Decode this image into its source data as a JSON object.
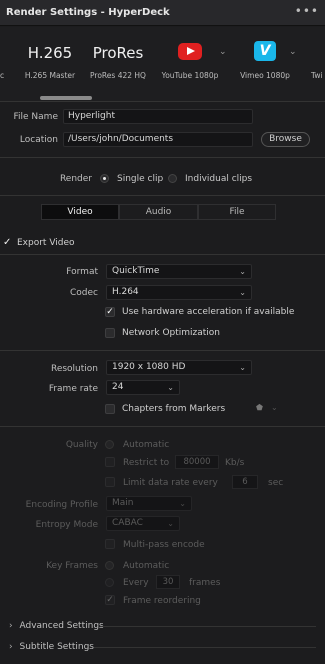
{
  "header": {
    "title": "Render Settings - HyperDeck",
    "menu_glyph": "•••"
  },
  "presets": [
    {
      "id": "h265-partial",
      "big": "",
      "label": "c"
    },
    {
      "id": "h265-master",
      "big": "H.265",
      "label": "H.265 Master"
    },
    {
      "id": "prores",
      "big": "ProRes",
      "label": "ProRes 422 HQ"
    },
    {
      "id": "youtube",
      "big": "",
      "label": "YouTube 1080p",
      "icon": "youtube-icon"
    },
    {
      "id": "vimeo",
      "big": "",
      "label": "Vimeo 1080p",
      "icon": "vimeo-icon",
      "glyph": "V"
    },
    {
      "id": "twitter-partial",
      "big": "",
      "label": "Twi"
    }
  ],
  "file": {
    "filename_label": "File Name",
    "filename_value": "Hyperlight",
    "location_label": "Location",
    "location_value": "/Users/john/Documents",
    "browse_label": "Browse"
  },
  "render": {
    "label": "Render",
    "single_clip": "Single clip",
    "individual_clips": "Individual clips",
    "selected": "single"
  },
  "tabs": [
    {
      "label": "Video",
      "active": true
    },
    {
      "label": "Audio",
      "active": false
    },
    {
      "label": "File",
      "active": false
    }
  ],
  "export_video": {
    "label": "Export Video",
    "checked": true
  },
  "format": {
    "label": "Format",
    "value": "QuickTime"
  },
  "codec": {
    "label": "Codec",
    "value": "H.264"
  },
  "hardware_accel": {
    "label": "Use hardware acceleration if available",
    "checked": true
  },
  "network_opt": {
    "label": "Network Optimization",
    "checked": false
  },
  "resolution": {
    "label": "Resolution",
    "value": "1920 x 1080 HD"
  },
  "frame_rate": {
    "label": "Frame rate",
    "value": "24"
  },
  "chapters": {
    "label": "Chapters from Markers",
    "checked": false
  },
  "quality": {
    "label": "Quality",
    "automatic": "Automatic",
    "restrict_to": "Restrict to",
    "restrict_value": "80000",
    "restrict_unit": "Kb/s",
    "limit_label": "Limit data rate every",
    "limit_value": "6",
    "limit_unit": "sec"
  },
  "encoding_profile": {
    "label": "Encoding Profile",
    "value": "Main"
  },
  "entropy_mode": {
    "label": "Entropy Mode",
    "value": "CABAC"
  },
  "multipass": {
    "label": "Multi-pass encode",
    "checked": false
  },
  "key_frames": {
    "label": "Key Frames",
    "automatic": "Automatic",
    "every": "Every",
    "every_value": "30",
    "frames": "frames",
    "reordering": "Frame reordering",
    "reordering_checked": true
  },
  "advanced_settings": "Advanced Settings",
  "subtitle_settings": "Subtitle Settings",
  "colors": {
    "accent_youtube": "#e02020",
    "accent_vimeo": "#1ab7ea",
    "background": "#1c1c1e"
  }
}
